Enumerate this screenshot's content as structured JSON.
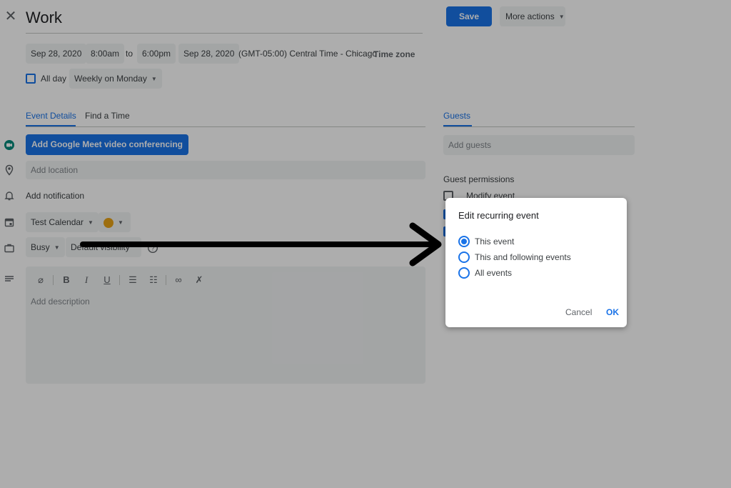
{
  "header": {
    "title": "Work",
    "save_label": "Save",
    "more_actions_label": "More actions"
  },
  "datetime": {
    "start_date": "Sep 28, 2020",
    "start_time": "8:00am",
    "to_label": "to",
    "end_time": "6:00pm",
    "end_date": "Sep 28, 2020",
    "timezone_text": "(GMT-05:00) Central Time - Chicago",
    "timezone_button": "Time zone",
    "all_day_label": "All day",
    "recurrence": "Weekly on Monday"
  },
  "tabs": {
    "event_details": "Event Details",
    "find_a_time": "Find a Time",
    "guests": "Guests"
  },
  "details": {
    "meet_button": "Add Google Meet video conferencing",
    "location_placeholder": "Add location",
    "add_notification": "Add notification",
    "calendar": "Test Calendar",
    "event_color": "#e8a317",
    "availability": "Busy",
    "visibility": "Default visibility",
    "description_placeholder": "Add description"
  },
  "guests": {
    "add_guests_placeholder": "Add guests",
    "permissions_title": "Guest permissions",
    "permission_modify": "Modify event"
  },
  "dialog": {
    "title": "Edit recurring event",
    "options": [
      "This event",
      "This and following events",
      "All events"
    ],
    "selected_option": "This event",
    "cancel_label": "Cancel",
    "ok_label": "OK"
  },
  "icons": {
    "close": "close-icon",
    "meet": "google-meet-icon",
    "location": "location-pin-icon",
    "notification": "bell-icon",
    "calendar": "calendar-icon",
    "status": "briefcase-icon",
    "description": "text-lines-icon",
    "help": "help-circle-icon",
    "annotation": "arrow-right-annotation"
  },
  "colors": {
    "accent": "#1a73e8",
    "meet_green": "#00897b",
    "overlay": "rgba(0,0,0,0.32)"
  }
}
